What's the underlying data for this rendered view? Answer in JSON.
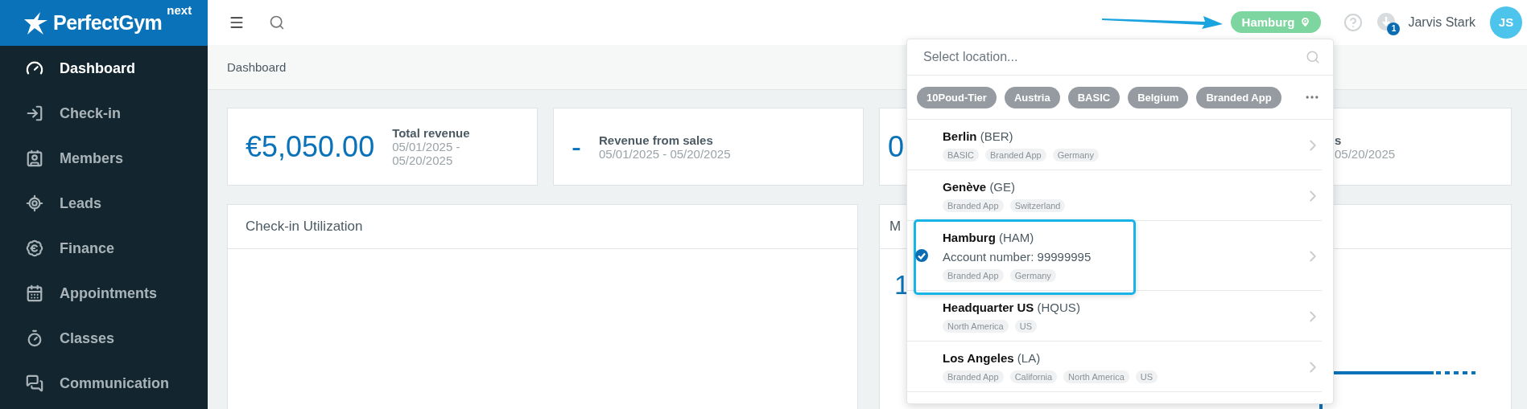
{
  "logo": {
    "name": "PerfectGym",
    "superscript": "next"
  },
  "sidebar": {
    "items": [
      {
        "label": "Dashboard",
        "selected": true
      },
      {
        "label": "Check-in",
        "selected": false
      },
      {
        "label": "Members",
        "selected": false
      },
      {
        "label": "Leads",
        "selected": false
      },
      {
        "label": "Finance",
        "selected": false
      },
      {
        "label": "Appointments",
        "selected": false
      },
      {
        "label": "Classes",
        "selected": false
      },
      {
        "label": "Communication",
        "selected": false
      }
    ]
  },
  "header": {
    "location": "Hamburg",
    "notification_count": "1",
    "user": "Jarvis Stark",
    "initials": "JS"
  },
  "breadcrumb": "Dashboard",
  "stat_cards": [
    {
      "value": "€5,050.00",
      "label": "Total revenue",
      "period": "05/01/2025 - 05/20/2025"
    },
    {
      "value": "-",
      "label": "Revenue from sales",
      "period": "05/01/2025 - 05/20/2025"
    },
    {
      "value": "0"
    },
    {
      "label": "s",
      "period": "05/20/2025"
    }
  ],
  "panels": [
    {
      "title": "Check-in Utilization"
    },
    {
      "title": "M",
      "value": "1"
    }
  ],
  "location_picker": {
    "placeholder": "Select location...",
    "filters": [
      "10Poud-Tier",
      "Austria",
      "BASIC",
      "Belgium",
      "Branded App"
    ],
    "locations": [
      {
        "name": "Berlin",
        "code": "(BER)",
        "tags": [
          "BASIC",
          "Branded App",
          "Germany"
        ],
        "selected": false
      },
      {
        "name": "Genève",
        "code": "(GE)",
        "tags": [
          "Branded App",
          "Switzerland"
        ],
        "selected": false
      },
      {
        "name": "Hamburg",
        "code": "(HAM)",
        "account": "Account number: 99999995",
        "tags": [
          "Branded App",
          "Germany"
        ],
        "selected": true
      },
      {
        "name": "Headquarter US",
        "code": "(HQUS)",
        "tags": [
          "North America",
          "US"
        ],
        "selected": false
      },
      {
        "name": "Los Angeles",
        "code": "(LA)",
        "tags": [
          "Branded App",
          "California",
          "North America",
          "US"
        ],
        "selected": false
      }
    ]
  }
}
